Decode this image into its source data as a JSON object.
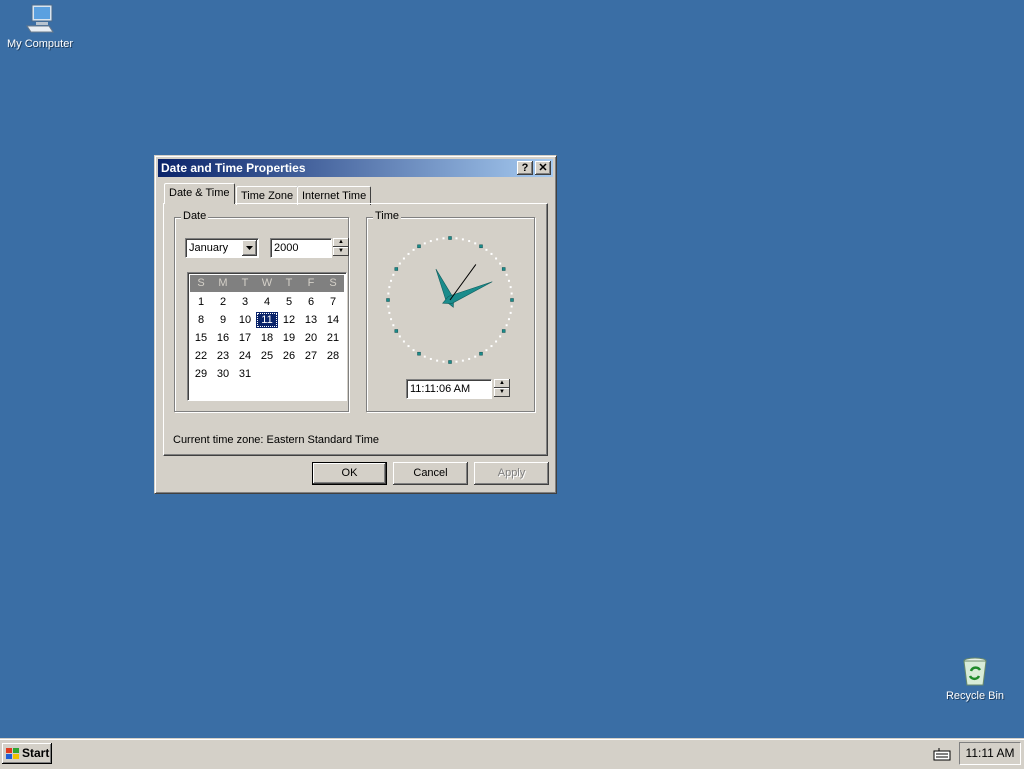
{
  "desktop": {
    "my_computer_label": "My Computer",
    "recycle_bin_label": "Recycle Bin",
    "background_color": "#3a6ea5"
  },
  "window": {
    "title": "Date and Time Properties",
    "help_label": "?",
    "close_label": "✕",
    "tabs": [
      "Date & Time",
      "Time Zone",
      "Internet Time"
    ],
    "date_group": {
      "legend": "Date",
      "month": "January",
      "year": "2000",
      "weekdays": [
        "S",
        "M",
        "T",
        "W",
        "T",
        "F",
        "S"
      ],
      "days": [
        [
          "",
          "",
          "",
          "",
          "",
          "",
          ""
        ],
        [
          "1",
          "2",
          "3",
          "4",
          "5",
          "6",
          "7"
        ],
        [
          "8",
          "9",
          "10",
          "11",
          "12",
          "13",
          "14"
        ],
        [
          "15",
          "16",
          "17",
          "18",
          "19",
          "20",
          "21"
        ],
        [
          "22",
          "23",
          "24",
          "25",
          "26",
          "27",
          "28"
        ],
        [
          "29",
          "30",
          "31",
          "",
          "",
          "",
          ""
        ]
      ],
      "selected_day": "11"
    },
    "time_group": {
      "legend": "Time",
      "time_value": "11:11:06 AM",
      "clock": {
        "hour": 11,
        "minute": 11,
        "second": 6,
        "hand_color": "#1a8c8c"
      }
    },
    "timezone_text": "Current time zone:  Eastern Standard Time",
    "buttons": {
      "ok": "OK",
      "cancel": "Cancel",
      "apply": "Apply"
    }
  },
  "taskbar": {
    "start_label": "Start",
    "clock": "11:11 AM"
  }
}
